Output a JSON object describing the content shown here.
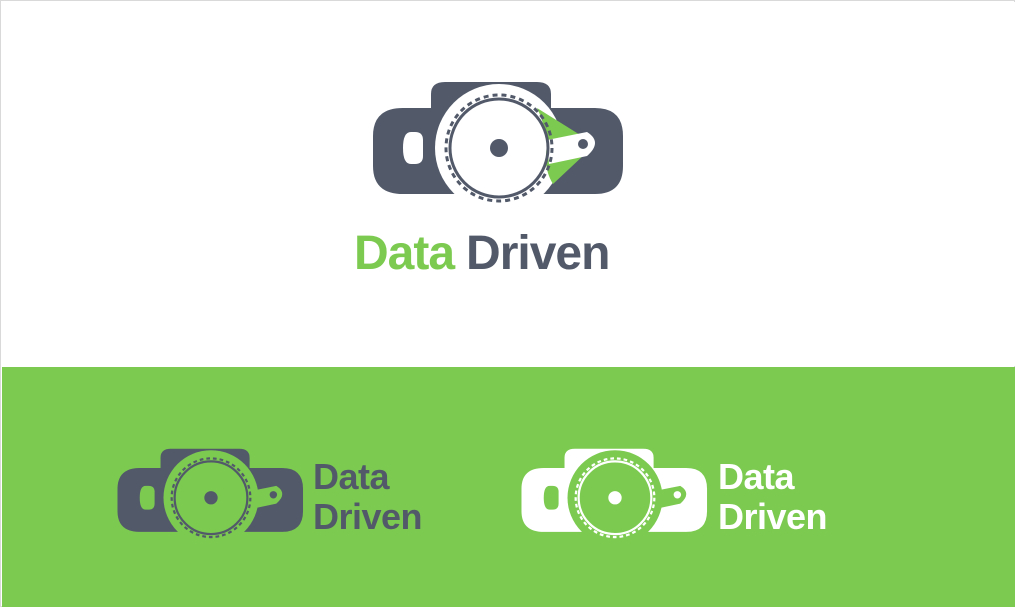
{
  "brand": {
    "word1": "Data",
    "word2": "Driven"
  },
  "colors": {
    "green": "#7ccb50",
    "slate": "#525a6a",
    "white": "#ffffff"
  },
  "variants": [
    {
      "id": "primary",
      "background": "white",
      "layout": "stacked-logo-over-wordmark",
      "word1_color": "green",
      "word2_color": "slate",
      "icon_color": "slate",
      "accent_color": "green"
    },
    {
      "id": "on-green-dark",
      "background": "green",
      "layout": "icon-left-wordmark-right",
      "word1_color": "slate",
      "word2_color": "slate",
      "icon_color": "slate",
      "accent_color": "green"
    },
    {
      "id": "on-green-white",
      "background": "green",
      "layout": "icon-left-wordmark-right",
      "word1_color": "white",
      "word2_color": "white",
      "icon_color": "white",
      "accent_color": "green"
    }
  ],
  "icon_name": "camera-gear-icon"
}
